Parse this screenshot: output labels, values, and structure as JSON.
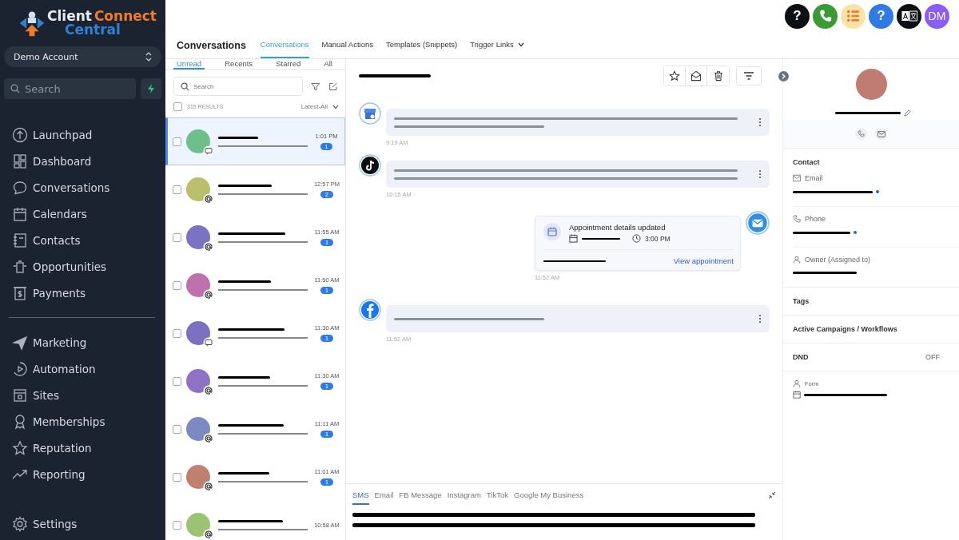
{
  "brand": {
    "first": "Client",
    "second": "Connect",
    "third": "Central"
  },
  "account": {
    "name": "Demo Account"
  },
  "sidebar_search": {
    "placeholder": "Search"
  },
  "nav_main": [
    {
      "label": "Launchpad",
      "kind": "launchpad"
    },
    {
      "label": "Dashboard",
      "kind": "dashboard"
    },
    {
      "label": "Conversations",
      "kind": "conversations"
    },
    {
      "label": "Calendars",
      "kind": "calendars"
    },
    {
      "label": "Contacts",
      "kind": "contacts"
    },
    {
      "label": "Opportunities",
      "kind": "opportunities"
    },
    {
      "label": "Payments",
      "kind": "payments"
    }
  ],
  "nav_more": [
    {
      "label": "Marketing",
      "kind": "marketing"
    },
    {
      "label": "Automation",
      "kind": "automation"
    },
    {
      "label": "Sites",
      "kind": "sites"
    },
    {
      "label": "Memberships",
      "kind": "memberships"
    },
    {
      "label": "Reputation",
      "kind": "reputation"
    },
    {
      "label": "Reporting",
      "kind": "reporting"
    }
  ],
  "nav_settings": {
    "label": "Settings"
  },
  "top_actions": [
    {
      "kind": "help-dark",
      "text": "?"
    },
    {
      "kind": "phone"
    },
    {
      "kind": "list"
    },
    {
      "kind": "help-blue",
      "text": "?"
    },
    {
      "kind": "translate"
    },
    {
      "kind": "avatar",
      "text": "DM"
    }
  ],
  "header": {
    "title": "Conversations",
    "tabs": [
      {
        "label": "Conversations",
        "selected": true,
        "dropdown": false
      },
      {
        "label": "Manual Actions",
        "selected": false,
        "dropdown": false
      },
      {
        "label": "Templates (Snippets)",
        "selected": false,
        "dropdown": false
      },
      {
        "label": "Trigger Links",
        "selected": false,
        "dropdown": true
      }
    ]
  },
  "list": {
    "filters": [
      {
        "label": "Unread",
        "selected": true
      },
      {
        "label": "Recents",
        "selected": false
      },
      {
        "label": "Starred",
        "selected": false
      },
      {
        "label": "All",
        "selected": false
      }
    ],
    "search": {
      "placeholder": "Search"
    },
    "select_all_checked": false,
    "results": "315 RESULTS",
    "sort": "Latest-All",
    "rows": [
      {
        "color": "#6dbf8c",
        "kind": "sms",
        "time": "1:01 PM",
        "unread": "1",
        "selected": true,
        "checked": false
      },
      {
        "color": "#b9bf6d",
        "kind": "email",
        "time": "12:57 PM",
        "unread": "2",
        "selected": false,
        "checked": false
      },
      {
        "color": "#7a72c2",
        "kind": "email",
        "time": "11:55 AM",
        "unread": "1",
        "selected": false,
        "checked": false
      },
      {
        "color": "#c071ad",
        "kind": "email",
        "time": "11:50 AM",
        "unread": "1",
        "selected": false,
        "checked": false
      },
      {
        "color": "#7c70c0",
        "kind": "sms",
        "time": "11:30 AM",
        "unread": "1",
        "selected": false,
        "checked": false
      },
      {
        "color": "#8f72c4",
        "kind": "email",
        "time": "11:30 AM",
        "unread": "1",
        "selected": false,
        "checked": false
      },
      {
        "color": "#7c8ac4",
        "kind": "email",
        "time": "11:11 AM",
        "unread": "1",
        "selected": false,
        "checked": false
      },
      {
        "color": "#c08070",
        "kind": "email",
        "time": "11:01 AM",
        "unread": "1",
        "selected": false,
        "checked": false
      },
      {
        "color": "#9cc274",
        "kind": "email",
        "time": "10:58 AM",
        "selected": false,
        "checked": false
      }
    ]
  },
  "chat": {
    "messages": [
      {
        "kind": "business",
        "time": "9:19 AM"
      },
      {
        "kind": "tiktok",
        "time": "10:15 AM"
      },
      {
        "kind": "appointment",
        "title": "Appointment details updated",
        "clock_time": "3:00 PM",
        "link": "View appointment",
        "time": "11:52 AM"
      },
      {
        "kind": "facebook",
        "time": "11:52 AM"
      }
    ]
  },
  "composer": {
    "tabs": [
      {
        "label": "SMS",
        "selected": true
      },
      {
        "label": "Email",
        "selected": false
      },
      {
        "label": "FB Message",
        "selected": false
      },
      {
        "label": "Instagram",
        "selected": false
      },
      {
        "label": "TikTok",
        "selected": false
      },
      {
        "label": "Google My Business",
        "selected": false
      }
    ]
  },
  "contact": {
    "section_title": "Contact",
    "fields": [
      {
        "label": "Email",
        "kind": "email"
      },
      {
        "label": "Phone",
        "kind": "phone"
      },
      {
        "label": "Owner (Assigned to)",
        "kind": "owner"
      }
    ],
    "tags": "Tags",
    "campaigns": "Active Campaigns / Workflows",
    "dnd": {
      "label": "DND",
      "value": "OFF"
    },
    "form": {
      "label": "Form"
    }
  }
}
